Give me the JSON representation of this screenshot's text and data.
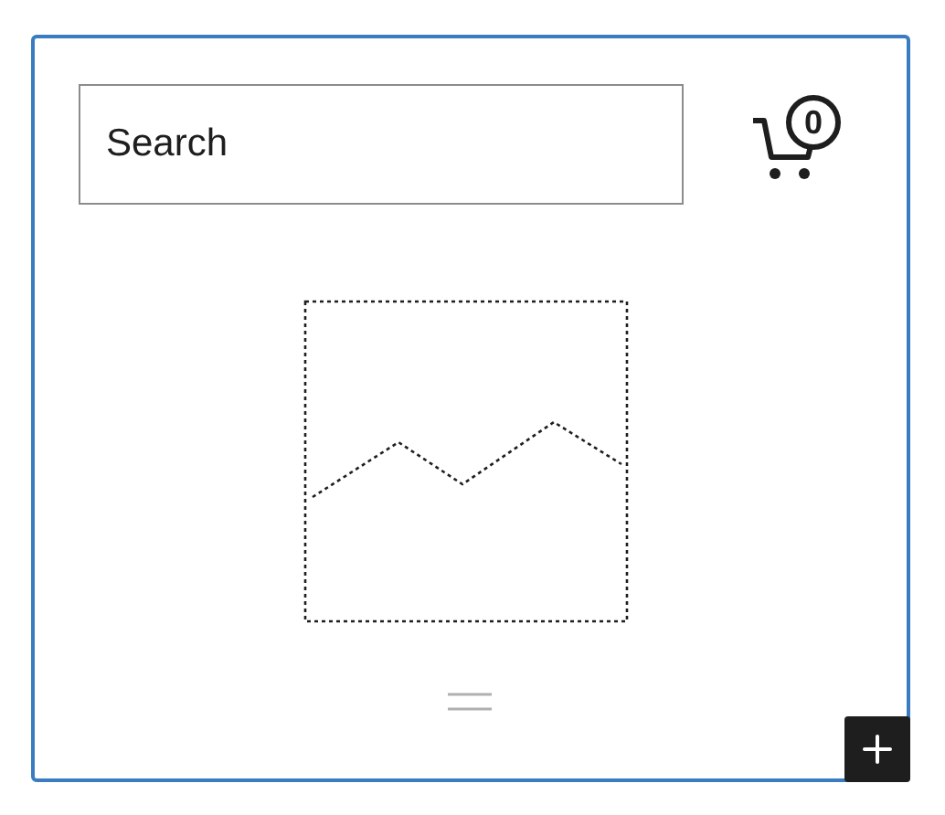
{
  "search": {
    "placeholder": "Search"
  },
  "cart": {
    "count": "0"
  }
}
